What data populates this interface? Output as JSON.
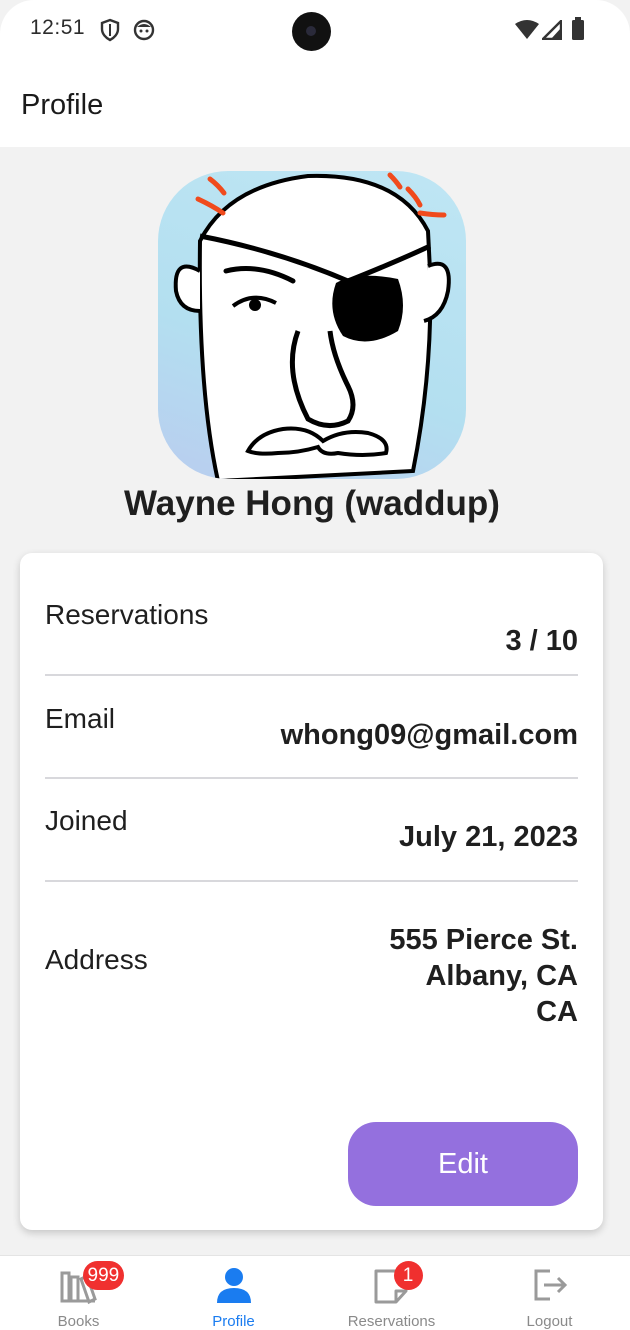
{
  "status_bar": {
    "time": "12:51"
  },
  "app_bar": {
    "title": "Profile"
  },
  "profile": {
    "name": "Wayne Hong (waddup)"
  },
  "details": {
    "reservations_label": "Reservations",
    "reservations_value": "3 / 10",
    "email_label": "Email",
    "email_value": "whong09@gmail.com",
    "joined_label": "Joined",
    "joined_value": "July 21, 2023",
    "address_label": "Address",
    "address_line1": "555 Pierce St.",
    "address_line2": "Albany, CA",
    "address_line3": "CA"
  },
  "edit_button": {
    "label": "Edit"
  },
  "bottom_nav": {
    "items": [
      {
        "label": "Books",
        "icon": "books-icon",
        "badge": "999"
      },
      {
        "label": "Profile",
        "icon": "person-icon",
        "active": true
      },
      {
        "label": "Reservations",
        "icon": "note-icon",
        "badge": "1"
      },
      {
        "label": "Logout",
        "icon": "logout-icon"
      }
    ]
  },
  "colors": {
    "accent_button": "#9470de",
    "active_nav": "#1a7cf0",
    "badge": "#f0302f"
  }
}
